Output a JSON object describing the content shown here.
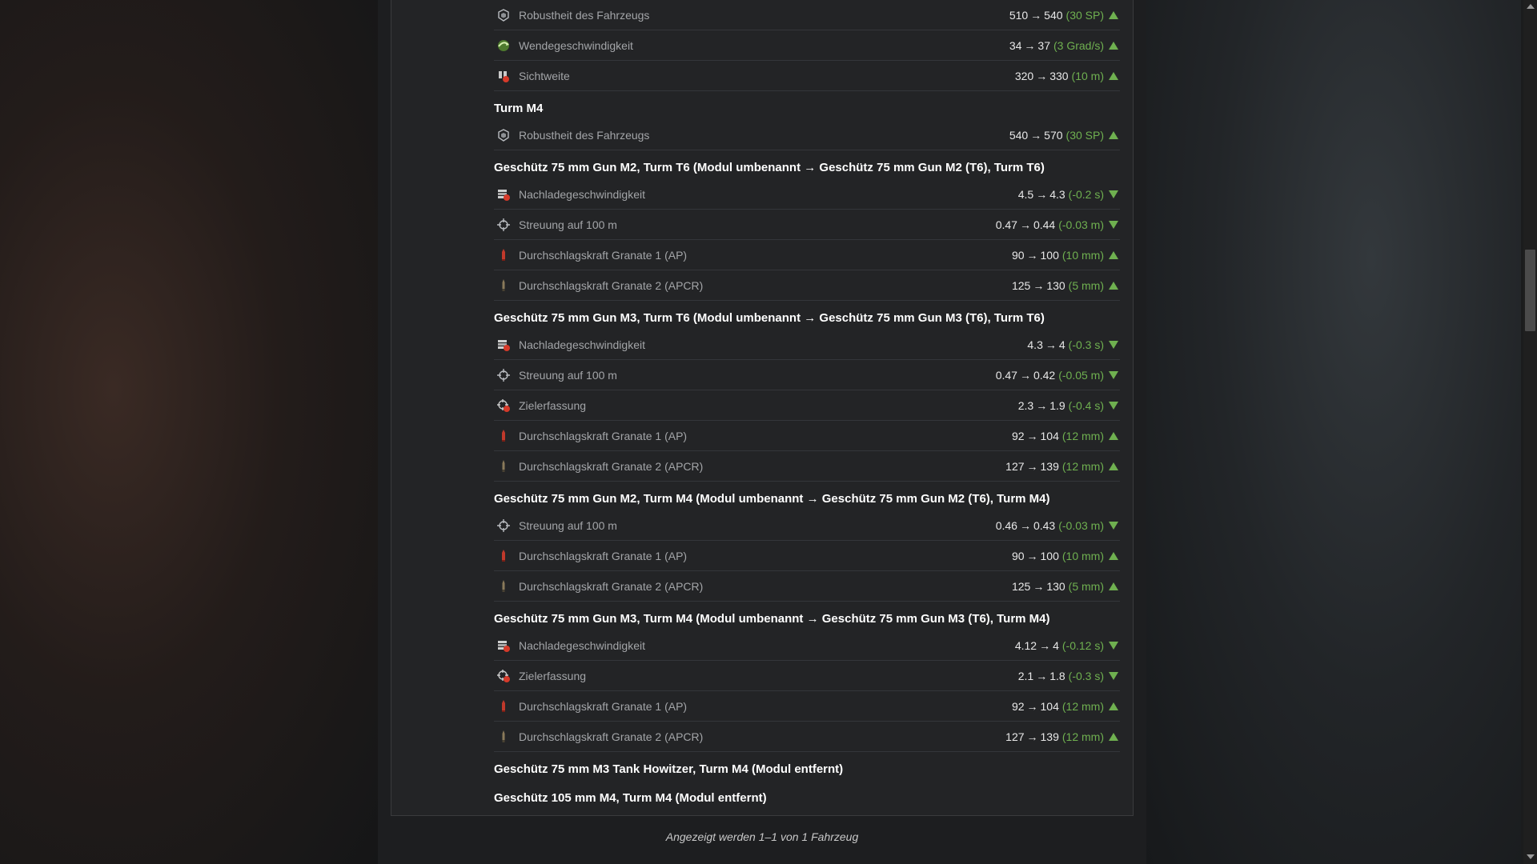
{
  "groups": [
    {
      "title": "",
      "rows": [
        {
          "icon": "armor-icon",
          "label": "Robustheit des Fahrzeugs",
          "from": "510",
          "to": "540",
          "delta": "(30 SP)",
          "dir": "up"
        },
        {
          "icon": "traverse-speed-icon",
          "label": "Wendegeschwindigkeit",
          "from": "34",
          "to": "37",
          "delta": "(3 Grad/s)",
          "dir": "up"
        },
        {
          "icon": "view-range-icon",
          "label": "Sichtweite",
          "from": "320",
          "to": "330",
          "delta": "(10 m)",
          "dir": "up"
        }
      ]
    },
    {
      "title": "Turm M4",
      "rows": [
        {
          "icon": "armor-icon",
          "label": "Robustheit des Fahrzeugs",
          "from": "540",
          "to": "570",
          "delta": "(30 SP)",
          "dir": "up"
        }
      ]
    },
    {
      "title": "Geschütz 75 mm Gun M2, Turm T6 (Modul umbenannt → Geschütz 75 mm Gun M2 (T6), Turm T6)",
      "rows": [
        {
          "icon": "reload-icon",
          "label": "Nachladegeschwindigkeit",
          "from": "4.5",
          "to": "4.3",
          "delta": "(-0.2 s)",
          "dir": "down"
        },
        {
          "icon": "dispersion-icon",
          "label": "Streuung auf 100 m",
          "from": "0.47",
          "to": "0.44",
          "delta": "(-0.03 m)",
          "dir": "down"
        },
        {
          "icon": "ap-shell-icon",
          "label": "Durchschlagskraft Granate 1 (AP)",
          "from": "90",
          "to": "100",
          "delta": "(10 mm)",
          "dir": "up"
        },
        {
          "icon": "apcr-shell-icon",
          "label": "Durchschlagskraft Granate 2 (APCR)",
          "from": "125",
          "to": "130",
          "delta": "(5 mm)",
          "dir": "up"
        }
      ]
    },
    {
      "title": "Geschütz 75 mm Gun M3, Turm T6 (Modul umbenannt → Geschütz 75 mm Gun M3 (T6), Turm T6)",
      "rows": [
        {
          "icon": "reload-icon",
          "label": "Nachladegeschwindigkeit",
          "from": "4.3",
          "to": "4",
          "delta": "(-0.3 s)",
          "dir": "down"
        },
        {
          "icon": "dispersion-icon",
          "label": "Streuung auf 100 m",
          "from": "0.47",
          "to": "0.42",
          "delta": "(-0.05 m)",
          "dir": "down"
        },
        {
          "icon": "aim-time-icon",
          "label": "Zielerfassung",
          "from": "2.3",
          "to": "1.9",
          "delta": "(-0.4 s)",
          "dir": "down"
        },
        {
          "icon": "ap-shell-icon",
          "label": "Durchschlagskraft Granate 1 (AP)",
          "from": "92",
          "to": "104",
          "delta": "(12 mm)",
          "dir": "up"
        },
        {
          "icon": "apcr-shell-icon",
          "label": "Durchschlagskraft Granate 2 (APCR)",
          "from": "127",
          "to": "139",
          "delta": "(12 mm)",
          "dir": "up"
        }
      ]
    },
    {
      "title": "Geschütz 75 mm Gun M2, Turm M4 (Modul umbenannt → Geschütz 75 mm Gun M2 (T6), Turm M4)",
      "rows": [
        {
          "icon": "dispersion-icon",
          "label": "Streuung auf 100 m",
          "from": "0.46",
          "to": "0.43",
          "delta": "(-0.03 m)",
          "dir": "down"
        },
        {
          "icon": "ap-shell-icon",
          "label": "Durchschlagskraft Granate 1 (AP)",
          "from": "90",
          "to": "100",
          "delta": "(10 mm)",
          "dir": "up"
        },
        {
          "icon": "apcr-shell-icon",
          "label": "Durchschlagskraft Granate 2 (APCR)",
          "from": "125",
          "to": "130",
          "delta": "(5 mm)",
          "dir": "up"
        }
      ]
    },
    {
      "title": "Geschütz 75 mm Gun M3, Turm M4 (Modul umbenannt → Geschütz 75 mm Gun M3 (T6), Turm M4)",
      "rows": [
        {
          "icon": "reload-icon",
          "label": "Nachladegeschwindigkeit",
          "from": "4.12",
          "to": "4",
          "delta": "(-0.12 s)",
          "dir": "down"
        },
        {
          "icon": "aim-time-icon",
          "label": "Zielerfassung",
          "from": "2.1",
          "to": "1.8",
          "delta": "(-0.3 s)",
          "dir": "down"
        },
        {
          "icon": "ap-shell-icon",
          "label": "Durchschlagskraft Granate 1 (AP)",
          "from": "92",
          "to": "104",
          "delta": "(12 mm)",
          "dir": "up"
        },
        {
          "icon": "apcr-shell-icon",
          "label": "Durchschlagskraft Granate 2 (APCR)",
          "from": "127",
          "to": "139",
          "delta": "(12 mm)",
          "dir": "up"
        }
      ]
    }
  ],
  "removed": [
    "Geschütz 75 mm M3 Tank Howitzer, Turm M4 (Modul entfernt)",
    "Geschütz 105 mm M4, Turm M4 (Modul entfernt)"
  ],
  "arrow_symbol": "→",
  "footer": "Angezeigt werden 1–1 von 1 Fahrzeug",
  "colors": {
    "positive": "#6fb050",
    "label": "#a3a5a8",
    "value": "#e8e8e8",
    "title": "#ffffff"
  }
}
